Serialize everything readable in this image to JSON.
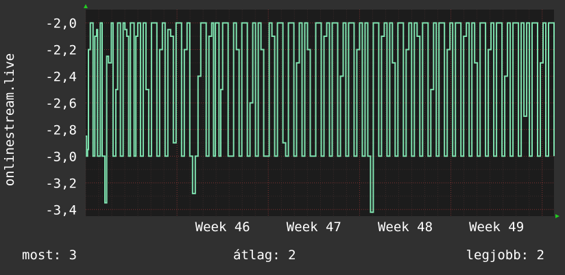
{
  "chart_data": {
    "type": "line",
    "ylabel": "onlinestream.live",
    "ylim": [
      -3.45,
      -1.9
    ],
    "yticks": [
      -2.0,
      -2.2,
      -2.4,
      -2.6,
      -2.8,
      -3.0,
      -3.2,
      -3.4
    ],
    "ytick_labels": [
      "-2,0",
      "-2,2",
      "-2,4",
      "-2,6",
      "-2,8",
      "-3,0",
      "-3,2",
      "-3,4"
    ],
    "xlim": [
      44.0,
      49.13
    ],
    "xticks": [
      45,
      46,
      47,
      48,
      49
    ],
    "xtick_labels": [
      "Week 46",
      "Week 47",
      "Week 48",
      "Week 49"
    ],
    "grid": true,
    "colors": {
      "background": "#303030",
      "plot": "#1c1c1c",
      "line": "#7fe3b0",
      "grid": "#7a3030",
      "axis_arrow": "#22cc22"
    },
    "series": [
      {
        "x": [
          44.0,
          44.01,
          44.02,
          44.03,
          44.05,
          44.07,
          44.08,
          44.1,
          44.12,
          44.13,
          44.15,
          44.16,
          44.18,
          44.19,
          44.21,
          44.23,
          44.25,
          44.28,
          44.3,
          44.33,
          44.35,
          44.36,
          44.38,
          44.4,
          44.41,
          44.43,
          44.45,
          44.47,
          44.49,
          44.51,
          44.53,
          44.55,
          44.57,
          44.6,
          44.63,
          44.66,
          44.69,
          44.72,
          44.75,
          44.78,
          44.81,
          44.84,
          44.87,
          44.9,
          44.93,
          44.96,
          44.99,
          45.02,
          45.05,
          45.08,
          45.11,
          45.14,
          45.17,
          45.2,
          45.23,
          45.26,
          45.29,
          45.32,
          45.35,
          45.38,
          45.4,
          45.42,
          45.44,
          45.46,
          45.48,
          45.5,
          45.53,
          45.56,
          45.59,
          45.62,
          45.65,
          45.68,
          45.71,
          45.74,
          45.77,
          45.8,
          45.83,
          45.86,
          45.89,
          45.92,
          45.95,
          45.98,
          46.01,
          46.04,
          46.07,
          46.1,
          46.13,
          46.16,
          46.19,
          46.22,
          46.25,
          46.28,
          46.31,
          46.34,
          46.37,
          46.4,
          46.43,
          46.46,
          46.49,
          46.52,
          46.55,
          46.58,
          46.61,
          46.64,
          46.67,
          46.7,
          46.73,
          46.76,
          46.79,
          46.82,
          46.85,
          46.88,
          46.91,
          46.94,
          46.97,
          47.0,
          47.03,
          47.06,
          47.09,
          47.12,
          47.15,
          47.18,
          47.21,
          47.24,
          47.27,
          47.3,
          47.33,
          47.36,
          47.39,
          47.42,
          47.45,
          47.48,
          47.51,
          47.54,
          47.57,
          47.6,
          47.63,
          47.66,
          47.69,
          47.72,
          47.75,
          47.78,
          47.81,
          47.84,
          47.87,
          47.9,
          47.93,
          47.96,
          47.99,
          48.02,
          48.05,
          48.08,
          48.11,
          48.14,
          48.17,
          48.2,
          48.23,
          48.26,
          48.29,
          48.32,
          48.35,
          48.38,
          48.41,
          48.44,
          48.47,
          48.5,
          48.53,
          48.56,
          48.59,
          48.62,
          48.65,
          48.68,
          48.71,
          48.74,
          48.77,
          48.8,
          48.83,
          48.86,
          48.89,
          48.92,
          48.95,
          48.98,
          49.01,
          49.04,
          49.07,
          49.1,
          49.13
        ],
        "y": [
          -2.85,
          -3.0,
          -2.95,
          -2.2,
          -2.0,
          -2.0,
          -3.0,
          -2.1,
          -2.05,
          -3.0,
          -3.0,
          -2.0,
          -3.0,
          -3.0,
          -3.35,
          -2.25,
          -2.3,
          -2.0,
          -3.0,
          -2.5,
          -2.0,
          -2.0,
          -3.0,
          -3.0,
          -2.0,
          -2.05,
          -2.1,
          -3.0,
          -2.0,
          -2.0,
          -3.0,
          -2.1,
          -2.0,
          -3.0,
          -2.0,
          -2.5,
          -3.0,
          -2.0,
          -2.0,
          -3.0,
          -2.2,
          -2.0,
          -3.0,
          -2.05,
          -2.1,
          -2.9,
          -2.0,
          -2.0,
          -3.0,
          -2.2,
          -2.0,
          -3.0,
          -3.28,
          -3.0,
          -2.4,
          -2.0,
          -2.0,
          -3.0,
          -2.1,
          -2.0,
          -3.0,
          -2.0,
          -2.0,
          -3.0,
          -2.5,
          -2.0,
          -2.0,
          -3.0,
          -3.0,
          -2.0,
          -2.2,
          -3.0,
          -2.0,
          -2.0,
          -3.0,
          -2.6,
          -2.0,
          -3.0,
          -2.0,
          -2.2,
          -3.0,
          -3.0,
          -2.0,
          -2.1,
          -3.0,
          -2.0,
          -2.0,
          -2.9,
          -3.0,
          -2.0,
          -2.0,
          -3.0,
          -2.3,
          -2.0,
          -3.0,
          -2.0,
          -2.2,
          -3.0,
          -3.0,
          -2.0,
          -2.0,
          -3.0,
          -2.1,
          -2.0,
          -3.0,
          -2.0,
          -2.0,
          -3.0,
          -2.4,
          -2.0,
          -3.0,
          -2.0,
          -2.0,
          -3.0,
          -2.2,
          -2.0,
          -3.0,
          -2.0,
          -3.0,
          -3.42,
          -2.0,
          -2.0,
          -3.0,
          -2.1,
          -2.0,
          -3.0,
          -2.0,
          -2.3,
          -3.0,
          -2.0,
          -2.0,
          -3.0,
          -2.2,
          -2.0,
          -3.0,
          -2.0,
          -2.1,
          -3.0,
          -2.0,
          -2.0,
          -3.0,
          -2.5,
          -2.0,
          -3.0,
          -2.0,
          -2.0,
          -3.0,
          -2.2,
          -2.0,
          -3.0,
          -2.0,
          -2.0,
          -3.0,
          -2.1,
          -2.0,
          -3.0,
          -2.0,
          -2.3,
          -3.0,
          -2.0,
          -2.0,
          -3.0,
          -2.2,
          -2.0,
          -3.0,
          -2.0,
          -2.0,
          -3.0,
          -2.4,
          -2.0,
          -3.0,
          -2.0,
          -2.0,
          -3.0,
          -2.0,
          -2.7,
          -2.0,
          -3.0,
          -2.0,
          -2.0,
          -3.0,
          -2.3,
          -2.0,
          -3.0,
          -2.0,
          -2.0,
          -3.0
        ]
      }
    ]
  },
  "footer": {
    "current": "most: 3",
    "average": "átlag: 2",
    "best": "legjobb: 2"
  }
}
